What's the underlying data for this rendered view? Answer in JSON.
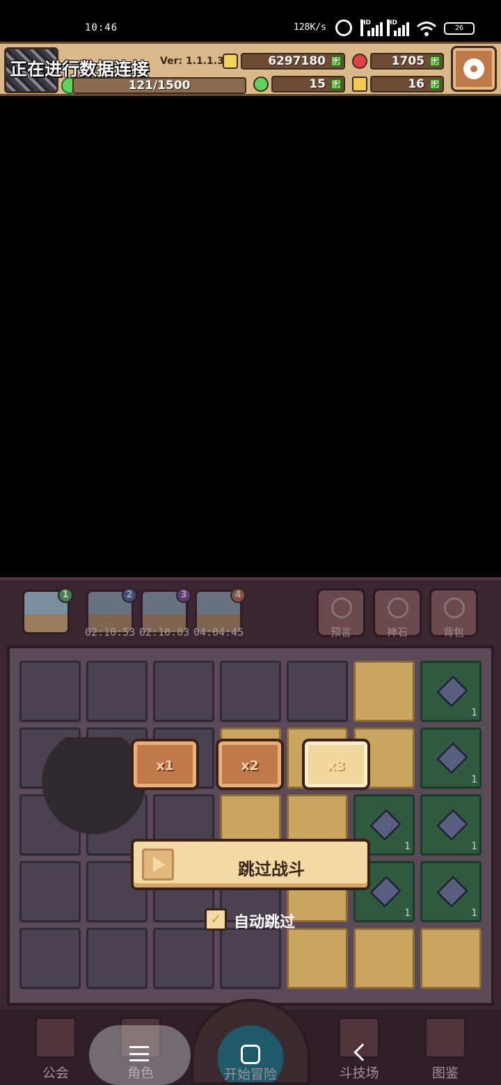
{
  "status_bar": {
    "time": "10:46",
    "net_speed": "128K/s",
    "battery": "26",
    "signal_labels": [
      "HD",
      "HD"
    ]
  },
  "hud": {
    "connecting_text": "正在进行数据连接",
    "version": "Ver: 1.1.1.3",
    "gold": "6297180",
    "gems": "1705",
    "energy": "121/1500",
    "clover": "15",
    "keys": "16",
    "colors": {
      "gold": "#f2d25a",
      "gem": "#e0404a",
      "energy": "#5ed45e",
      "key": "#f2c94c"
    }
  },
  "expedition_slots": [
    {
      "num": "1",
      "timer": "",
      "badge_color": "#4f9a5a"
    },
    {
      "num": "2",
      "timer": "02:10:53",
      "badge_color": "#3f73b8"
    },
    {
      "num": "3",
      "timer": "02:10:03",
      "badge_color": "#7c4fb0"
    },
    {
      "num": "4",
      "timer": "04:04:45",
      "badge_color": "#c07a4a"
    }
  ],
  "side_buttons": [
    {
      "label": "预言",
      "icon": "crystal-ball-icon"
    },
    {
      "label": "神石",
      "icon": "rune-stone-icon"
    },
    {
      "label": "背包",
      "icon": "backpack-icon"
    }
  ],
  "board": {
    "gem_counts": [
      "1",
      "1",
      "1",
      "1",
      "1",
      "1"
    ]
  },
  "speed_buttons": [
    "x1",
    "x2",
    "x3"
  ],
  "speed_selected": "x3",
  "skip_battle": {
    "label": "跳过战斗"
  },
  "auto_skip": {
    "label": "自动跳过",
    "checked": true
  },
  "bottom_nav": {
    "items": [
      "公会",
      "角色",
      "开始冒险",
      "斗技场",
      "图鉴"
    ]
  }
}
